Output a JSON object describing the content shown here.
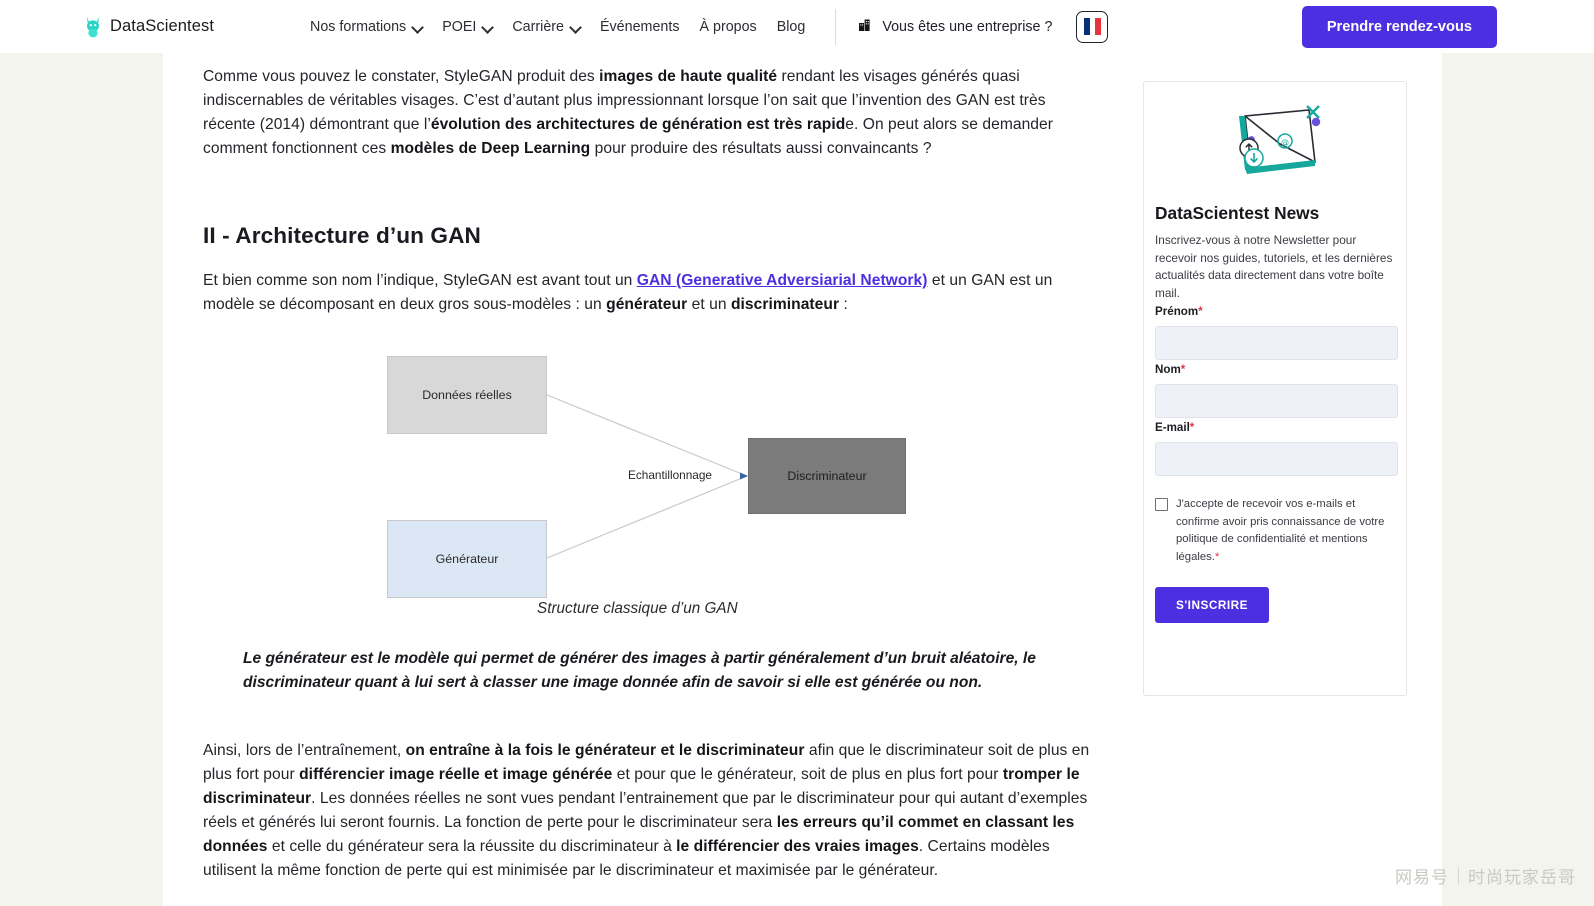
{
  "header": {
    "brand_name": "DataScientest",
    "nav": [
      {
        "label": "Nos formations",
        "has_chevron": true
      },
      {
        "label": "POEI",
        "has_chevron": true
      },
      {
        "label": "Carrière",
        "has_chevron": true
      },
      {
        "label": "Événements",
        "has_chevron": false
      },
      {
        "label": "À propos",
        "has_chevron": false
      },
      {
        "label": "Blog",
        "has_chevron": false
      }
    ],
    "entreprise_label": "Vous êtes une entreprise ?",
    "entreprise_icon": "building-icon",
    "language_flag": "french-flag-icon",
    "cta_label": "Prendre rendez-vous",
    "accent_color": "#4b2fe0",
    "brand_icon_color": "#2ad4c4"
  },
  "article": {
    "intro": {
      "p1_a": "Comme vous pouvez le constater, StyleGAN produit des ",
      "p1_b": "images de haute qualité",
      "p1_c": " rendant les visages générés quasi indiscernables de véritables visages. C’est d’autant plus impressionnant lorsque l’on sait que l’invention des GAN est très récente (2014) démontrant que l’",
      "p1_d": "évolution des architectures de génération est très rapid",
      "p1_e": "e. On peut alors se demander comment fonctionnent ces ",
      "p1_f": "modèles de Deep Learning",
      "p1_g": " pour produire des résultats aussi convaincants ?"
    },
    "heading2": "II - Architecture d’un GAN",
    "p2": {
      "a": "Et bien comme son nom l’indique, StyleGAN est avant tout un ",
      "link": "GAN (Generative Adversiarial Network)",
      "b": " et un GAN est un modèle se décomposant en deux gros sous-modèles : un ",
      "c": "générateur",
      "d": " et un ",
      "e": "discriminateur",
      "f": " :"
    },
    "quote": "Le générateur est le modèle qui permet de générer des images à partir généralement d’un bruit aléatoire, le discriminateur quant à lui sert à classer une image donnée afin de savoir si elle est générée ou non.",
    "p3": {
      "a": "Ainsi, lors de l’entraînement, ",
      "b": "on entraîne à la fois le générateur et le discriminateur",
      "c": " afin que le discriminateur soit de plus en plus fort pour ",
      "d": "différencier image réelle et image générée",
      "e": " et pour que le générateur, soit de plus en plus fort pour ",
      "f": "tromper le discriminateur",
      "g": ". Les données réelles ne sont vues pendant l’entrainement que par le discriminateur pour qui autant d’exemples réels et générés lui seront fournis. La fonction de perte pour le discriminateur sera ",
      "h": "les erreurs qu’il commet en classant les données",
      "i": " et celle du générateur sera la réussite du discriminateur à ",
      "j": "le différencier des vraies images",
      "k": ". Certains modèles utilisent la même fonction de perte qui est minimisée par le discriminateur et maximisée par le générateur."
    }
  },
  "diagram": {
    "box_real": "Données réelles",
    "box_generator": "Générateur",
    "box_discriminator": "Discriminateur",
    "edge_label": "Echantillonnage",
    "caption": "Structure classique d’un GAN",
    "colors": {
      "real_fill": "#d8d8d8",
      "generator_fill": "#dce7f5",
      "discriminator_fill": "#7b7b7b",
      "connector": "#c6c6c6",
      "arrowhead": "#3b63a8"
    }
  },
  "newsletter": {
    "illustration": "envelope-icon",
    "title": "DataScientest News",
    "description": "Inscrivez-vous à notre Newsletter pour recevoir nos guides, tutoriels, et les dernières actualités data directement dans votre boîte mail.",
    "fields": [
      {
        "label": "Prénom",
        "required": "*",
        "value": "",
        "placeholder": ""
      },
      {
        "label": "Nom",
        "required": "*",
        "value": "",
        "placeholder": ""
      },
      {
        "label": "E-mail",
        "required": "*",
        "value": "",
        "placeholder": ""
      }
    ],
    "consent_text": "J'accepte de recevoir vos e-mails et confirme avoir pris connaissance de votre politique de confidentialité et mentions légales.",
    "consent_required": "*",
    "consent_checked": false,
    "submit_label": "S'INSCRIRE"
  },
  "watermark": {
    "left": "网易号",
    "right": "时尚玩家岳哥"
  }
}
